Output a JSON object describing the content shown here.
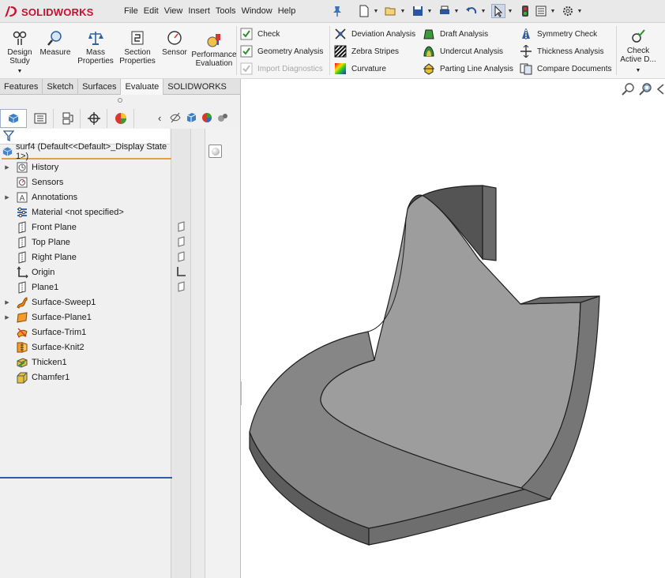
{
  "app": {
    "logo_text": "SOLIDWORKS",
    "brand_color": "#c8102e"
  },
  "menu": [
    "File",
    "Edit",
    "View",
    "Insert",
    "Tools",
    "Window",
    "Help"
  ],
  "quick_access": [
    {
      "name": "new-document-icon",
      "dropdown": true
    },
    {
      "name": "open-icon",
      "dropdown": true
    },
    {
      "name": "save-icon",
      "dropdown": true
    },
    {
      "name": "print-icon",
      "dropdown": true
    },
    {
      "name": "undo-icon",
      "dropdown": true
    },
    {
      "name": "select-arrow-icon",
      "dropdown": true,
      "selected": true
    },
    {
      "name": "rebuild-icon",
      "dropdown": false
    },
    {
      "name": "file-properties-icon",
      "dropdown": true
    },
    {
      "name": "options-gear-icon",
      "dropdown": true
    }
  ],
  "ribbon": {
    "large_buttons": [
      {
        "label1": "Design",
        "label2": "Study",
        "icon": "design-study-icon",
        "dropdown": true
      },
      {
        "label1": "Measure",
        "label2": "",
        "icon": "measure-icon",
        "dropdown": false
      },
      {
        "label1": "Mass",
        "label2": "Properties",
        "icon": "mass-properties-icon",
        "dropdown": false
      },
      {
        "label1": "Section",
        "label2": "Properties",
        "icon": "section-properties-icon",
        "dropdown": false
      },
      {
        "label1": "Sensor",
        "label2": "",
        "icon": "sensor-icon",
        "dropdown": false
      },
      {
        "label1": "Performance",
        "label2": "Evaluation",
        "icon": "performance-evaluation-icon",
        "dropdown": false
      }
    ],
    "col1": [
      {
        "label": "Check",
        "icon": "check-icon",
        "disabled": false
      },
      {
        "label": "Geometry Analysis",
        "icon": "geometry-analysis-icon",
        "disabled": false
      },
      {
        "label": "Import Diagnostics",
        "icon": "import-diagnostics-icon",
        "disabled": true
      }
    ],
    "col2": [
      {
        "label": "Deviation Analysis",
        "icon": "deviation-analysis-icon",
        "disabled": false
      },
      {
        "label": "Zebra Stripes",
        "icon": "zebra-stripes-icon",
        "disabled": false
      },
      {
        "label": "Curvature",
        "icon": "curvature-icon",
        "disabled": false
      }
    ],
    "col3": [
      {
        "label": "Draft Analysis",
        "icon": "draft-analysis-icon",
        "disabled": false
      },
      {
        "label": "Undercut Analysis",
        "icon": "undercut-analysis-icon",
        "disabled": false
      },
      {
        "label": "Parting Line Analysis",
        "icon": "parting-line-analysis-icon",
        "disabled": false
      }
    ],
    "col4": [
      {
        "label": "Symmetry Check",
        "icon": "symmetry-check-icon",
        "disabled": false
      },
      {
        "label": "Thickness Analysis",
        "icon": "thickness-analysis-icon",
        "disabled": false
      },
      {
        "label": "Compare Documents",
        "icon": "compare-documents-icon",
        "disabled": false
      }
    ],
    "check_active": {
      "label1": "Check",
      "label2": "Active D...",
      "icon": "check-active-document-icon"
    }
  },
  "tabs": [
    {
      "label": "Features",
      "active": false
    },
    {
      "label": "Sketch",
      "active": false
    },
    {
      "label": "Surfaces",
      "active": false
    },
    {
      "label": "Evaluate",
      "active": true
    },
    {
      "label": "SOLIDWORKS MBD",
      "active": false
    }
  ],
  "panel_tabs": [
    {
      "name": "featuremanager-tab",
      "active": true
    },
    {
      "name": "propertymanager-tab",
      "active": false
    },
    {
      "name": "configurationmanager-tab",
      "active": false
    },
    {
      "name": "dimxpertmanager-tab",
      "active": false
    },
    {
      "name": "displaymanager-tab",
      "active": false
    }
  ],
  "tree": {
    "root_label": "surf4  (Default<<Default>_Display State 1>)",
    "items": [
      {
        "label": "History",
        "icon": "history-icon",
        "expandable": true
      },
      {
        "label": "Sensors",
        "icon": "sensors-icon",
        "expandable": false
      },
      {
        "label": "Annotations",
        "icon": "annotations-icon",
        "expandable": true
      },
      {
        "label": "Material <not specified>",
        "icon": "material-icon",
        "expandable": false
      },
      {
        "label": "Front Plane",
        "icon": "plane-icon",
        "expandable": false
      },
      {
        "label": "Top Plane",
        "icon": "plane-icon",
        "expandable": false
      },
      {
        "label": "Right Plane",
        "icon": "plane-icon",
        "expandable": false
      },
      {
        "label": "Origin",
        "icon": "origin-icon",
        "expandable": false
      },
      {
        "label": "Plane1",
        "icon": "plane-icon",
        "expandable": false
      },
      {
        "label": "Surface-Sweep1",
        "icon": "surface-sweep-icon",
        "expandable": true
      },
      {
        "label": "Surface-Plane1",
        "icon": "surface-plane-icon",
        "expandable": true
      },
      {
        "label": "Surface-Trim1",
        "icon": "surface-trim-icon",
        "expandable": false
      },
      {
        "label": "Surface-Knit2",
        "icon": "surface-knit-icon",
        "expandable": false
      },
      {
        "label": "Thicken1",
        "icon": "thicken-icon",
        "expandable": false
      },
      {
        "label": "Chamfer1",
        "icon": "chamfer-icon",
        "expandable": false
      }
    ]
  }
}
